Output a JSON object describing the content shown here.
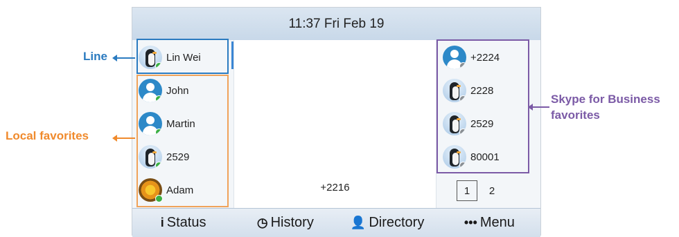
{
  "header": {
    "datetime": "11:37 Fri Feb 19"
  },
  "line_key": {
    "label": "Lin Wei",
    "avatar": "penguin",
    "status": "green"
  },
  "local_favorites": [
    {
      "label": "John",
      "avatar": "person",
      "status": "green"
    },
    {
      "label": "Martin",
      "avatar": "person",
      "status": "green"
    },
    {
      "label": "2529",
      "avatar": "penguin",
      "status": "green"
    },
    {
      "label": "Adam",
      "avatar": "flower",
      "status": "green"
    }
  ],
  "skype_favorites": [
    {
      "label": "+2224",
      "avatar": "person",
      "status": "grey"
    },
    {
      "label": "2228",
      "avatar": "penguin",
      "status": "grey"
    },
    {
      "label": "2529",
      "avatar": "penguin",
      "status": "grey"
    },
    {
      "label": "80001",
      "avatar": "penguin",
      "status": "grey"
    }
  ],
  "middle": {
    "number": "+2216"
  },
  "pager": {
    "page1": "1",
    "page2": "2"
  },
  "softkeys": [
    {
      "icon": "info-icon",
      "glyph": "i",
      "label": "Status"
    },
    {
      "icon": "clock-icon",
      "glyph": "◷",
      "label": "History"
    },
    {
      "icon": "person-icon",
      "glyph": "👤",
      "label": "Directory"
    },
    {
      "icon": "more-icon",
      "glyph": "•••",
      "label": "Menu"
    }
  ],
  "callouts": {
    "line": "Line",
    "local": "Local favorites",
    "skype_line1": "Skype for Business",
    "skype_line2": "favorites"
  },
  "colors": {
    "line": "#2b7bc0",
    "local": "#f08a2c",
    "skype": "#7b5aa6"
  }
}
